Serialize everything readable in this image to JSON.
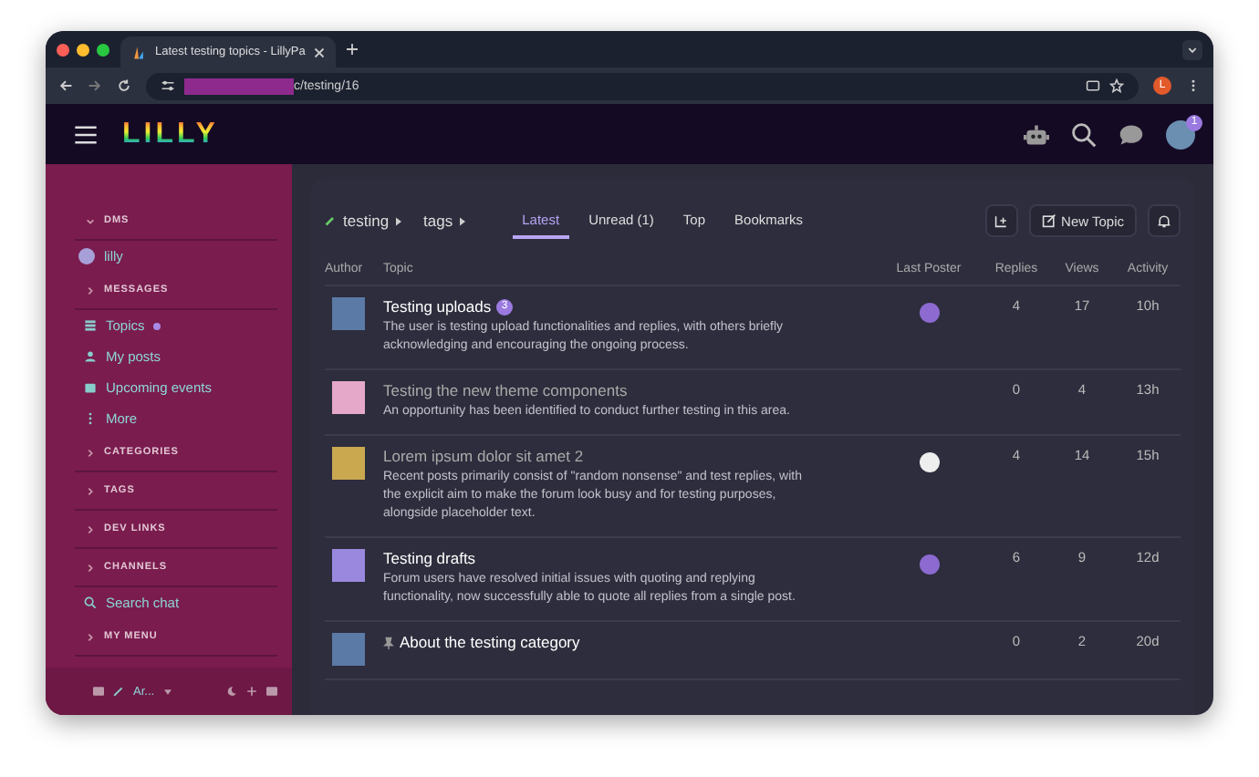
{
  "browser": {
    "tab_title": "Latest testing topics - LillyPa",
    "url": "c/testing/16",
    "profile_initial": "L"
  },
  "header": {
    "logo": "LILLY",
    "notification_count": "1"
  },
  "sidebar": {
    "items": [
      {
        "kind": "section",
        "label": "DMS",
        "expanded": true
      },
      {
        "kind": "dm",
        "label": "lilly"
      },
      {
        "kind": "section",
        "label": "MESSAGES",
        "expanded": false
      },
      {
        "kind": "link",
        "label": "Topics",
        "unread": true
      },
      {
        "kind": "link",
        "label": "My posts",
        "unread": false
      },
      {
        "kind": "link",
        "label": "Upcoming events",
        "unread": false
      },
      {
        "kind": "link",
        "label": "More",
        "unread": false
      },
      {
        "kind": "section",
        "label": "CATEGORIES",
        "expanded": false
      },
      {
        "kind": "section",
        "label": "TAGS",
        "expanded": false
      },
      {
        "kind": "section",
        "label": "DEV LINKS",
        "expanded": false
      },
      {
        "kind": "section",
        "label": "CHANNELS",
        "expanded": false
      },
      {
        "kind": "link",
        "label": "Search chat",
        "unread": false
      },
      {
        "kind": "section",
        "label": "MY MENU",
        "expanded": false
      }
    ],
    "footer": {
      "theme_label": "Ar..."
    }
  },
  "nav": {
    "category": "testing",
    "tags": "tags",
    "tabs": [
      {
        "label": "Latest",
        "selected": true
      },
      {
        "label": "Unread (1)",
        "selected": false
      },
      {
        "label": "Top",
        "selected": false
      },
      {
        "label": "Bookmarks",
        "selected": false
      }
    ],
    "new_topic": "New Topic"
  },
  "table": {
    "columns": [
      "Author",
      "Topic",
      "Last Poster",
      "Replies",
      "Views",
      "Activity"
    ],
    "rows": [
      {
        "title": "Testing uploads",
        "visited": false,
        "pinned": false,
        "badge": "3",
        "excerpt": "The user is testing upload functionalities and replies, with others briefly acknowledging and encouraging the ongoing process.",
        "has_last_poster": true,
        "replies": "4",
        "views": "17",
        "activity": "10h"
      },
      {
        "title": "Testing the new theme components",
        "visited": true,
        "pinned": false,
        "excerpt": "An opportunity has been identified to conduct further testing in this area.",
        "has_last_poster": false,
        "replies": "0",
        "views": "4",
        "activity": "13h"
      },
      {
        "title": "Lorem ipsum dolor sit amet 2",
        "visited": true,
        "pinned": false,
        "excerpt": "Recent posts primarily consist of \"random nonsense\" and test replies, with the explicit aim to make the forum look busy and for testing purposes, alongside placeholder text.",
        "has_last_poster": true,
        "replies": "4",
        "views": "14",
        "activity": "15h"
      },
      {
        "title": "Testing drafts",
        "visited": false,
        "pinned": false,
        "excerpt": "Forum users have resolved initial issues with quoting and replying functionality, now successfully able to quote all replies from a single post.",
        "has_last_poster": true,
        "replies": "6",
        "views": "9",
        "activity": "12d"
      },
      {
        "title": "About the testing category",
        "visited": false,
        "pinned": true,
        "has_last_poster": false,
        "replies": "0",
        "views": "2",
        "activity": "20d"
      }
    ]
  }
}
